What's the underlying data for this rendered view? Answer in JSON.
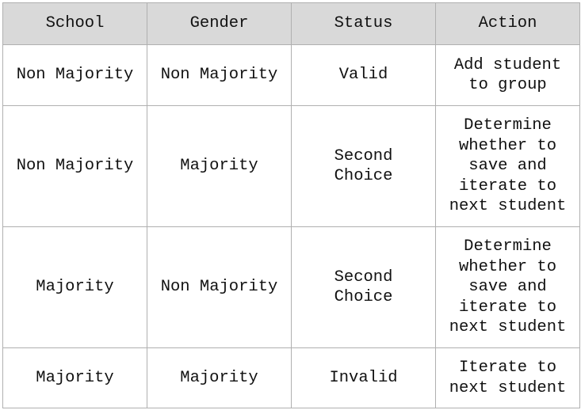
{
  "table": {
    "headers": [
      "School",
      "Gender",
      "Status",
      "Action"
    ],
    "rows": [
      [
        "Non Majority",
        "Non Majority",
        "Valid",
        "Add student\nto group"
      ],
      [
        "Non Majority",
        "Majority",
        "Second\nChoice",
        "Determine\nwhether to\nsave and\niterate to\nnext student"
      ],
      [
        "Majority",
        "Non Majority",
        "Second\nChoice",
        "Determine\nwhether to\nsave and\niterate to\nnext student"
      ],
      [
        "Majority",
        "Majority",
        "Invalid",
        "Iterate to\nnext student"
      ]
    ]
  }
}
